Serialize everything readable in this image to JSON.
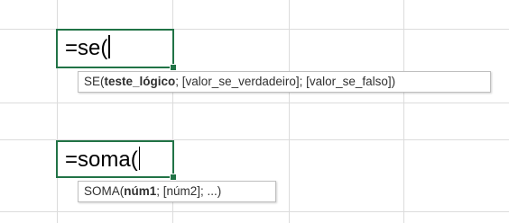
{
  "cells": [
    {
      "formula": "=se("
    },
    {
      "formula": "=soma("
    }
  ],
  "tooltips": [
    {
      "func": "SE",
      "open": "(",
      "bold_arg": "teste_lógico",
      "rest": "; [valor_se_verdadeiro]; [valor_se_falso])"
    },
    {
      "func": "SOMA",
      "open": "(",
      "bold_arg": "núm1",
      "rest": "; [núm2]; ...)"
    }
  ],
  "colors": {
    "active_cell_border": "#217346",
    "gridline": "#dcdcdc"
  }
}
